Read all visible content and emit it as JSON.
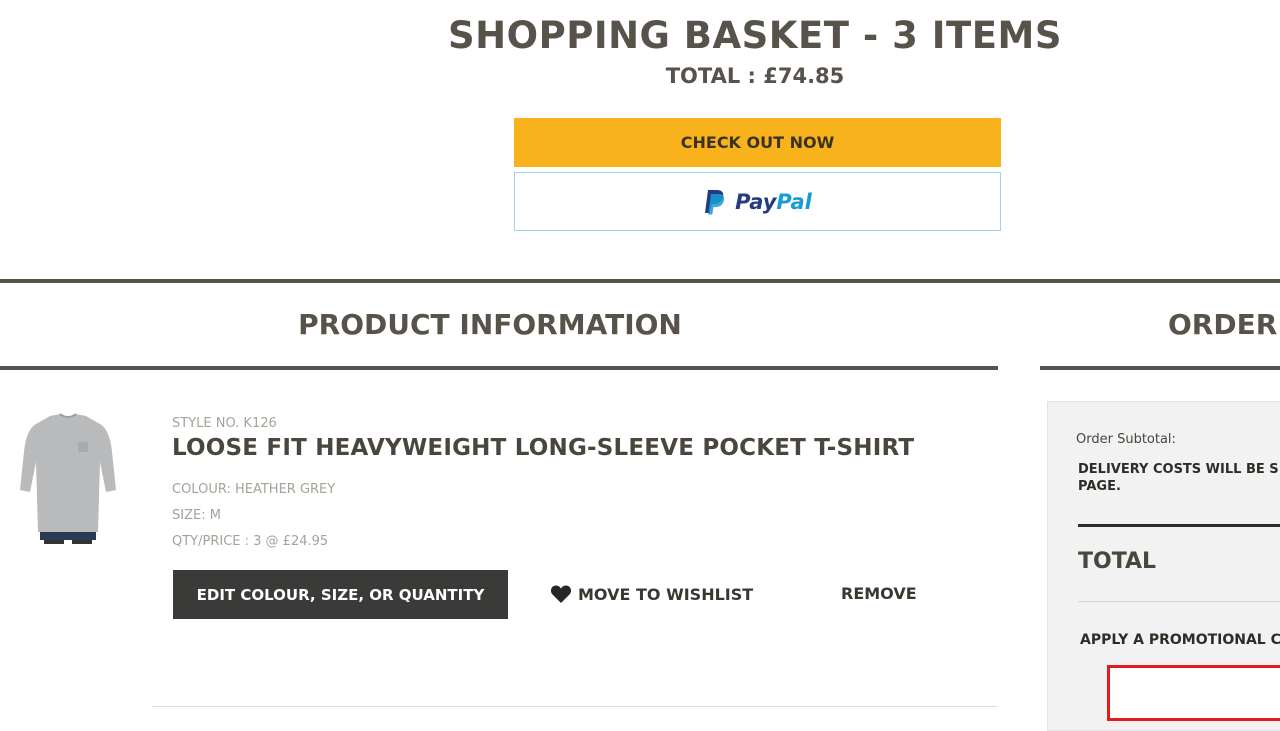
{
  "header": {
    "title": "SHOPPING BASKET - 3 ITEMS",
    "total": "TOTAL : £74.85",
    "checkout_label": "CHECK OUT NOW",
    "paypal_label_pay": "Pay",
    "paypal_label_pal": "Pal"
  },
  "sections": {
    "product_information": "PRODUCT INFORMATION",
    "order_summary": "ORDER S"
  },
  "product": {
    "style_no": "STYLE NO. K126",
    "name": "LOOSE FIT HEAVYWEIGHT LONG-SLEEVE POCKET T-SHIRT",
    "colour": "COLOUR: HEATHER GREY",
    "size": "SIZE: M",
    "qty_price": "QTY/PRICE : 3 @ £24.95",
    "edit_label": "EDIT COLOUR, SIZE, OR QUANTITY",
    "wishlist_label": "MOVE TO WISHLIST",
    "remove_label": "REMOVE",
    "thumb_icon": "long-sleeve-t-shirt"
  },
  "summary": {
    "subtotal_label": "Order Subtotal:",
    "delivery_note": "DELIVERY COSTS WILL BE S PAGE.",
    "total_label": "TOTAL",
    "promo_label": "APPLY A PROMOTIONAL C",
    "promo_value": ""
  },
  "colors": {
    "checkout": "#f7b21c",
    "paypal_dark": "#253b80",
    "paypal_light": "#179bd7",
    "promo_border": "#e01c1c",
    "heading": "#58534a"
  }
}
